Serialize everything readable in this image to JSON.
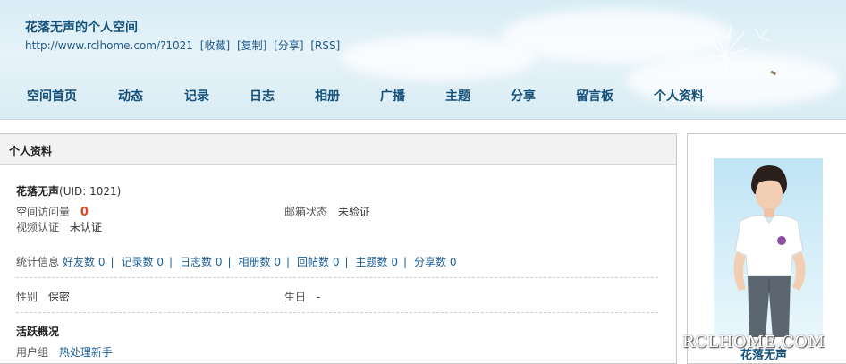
{
  "header": {
    "space_title": "花落无声的个人空间",
    "url": "http://www.rclhome.com/?1021",
    "links": [
      "[收藏]",
      "[复制]",
      "[分享]",
      "[RSS]"
    ]
  },
  "nav": [
    "空间首页",
    "动态",
    "记录",
    "日志",
    "相册",
    "广播",
    "主题",
    "分享",
    "留言板",
    "个人资料"
  ],
  "panel": {
    "title": "个人资料",
    "username": "花落无声",
    "uid": "(UID: 1021)",
    "visits_label": "空间访问量",
    "visits_value": "0",
    "email_label": "邮箱状态",
    "email_value": "未验证",
    "video_label": "视频认证",
    "video_value": "未认证",
    "stats_label": "统计信息",
    "stats": [
      "好友数 0",
      "记录数 0",
      "日志数 0",
      "相册数 0",
      "回帖数 0",
      "主题数 0",
      "分享数 0"
    ],
    "gender_label": "性别",
    "gender_value": "保密",
    "birthday_label": "生日",
    "birthday_value": "-",
    "activity_title": "活跃概况",
    "group_label": "用户组",
    "group_value": "热处理新手"
  },
  "sidebar": {
    "watermark": "RCLHOME.COM",
    "avatar_name": "花落无声"
  },
  "colors": {
    "link": "#1a5f99",
    "nav": "#14507a",
    "visits": "#e0471b"
  }
}
